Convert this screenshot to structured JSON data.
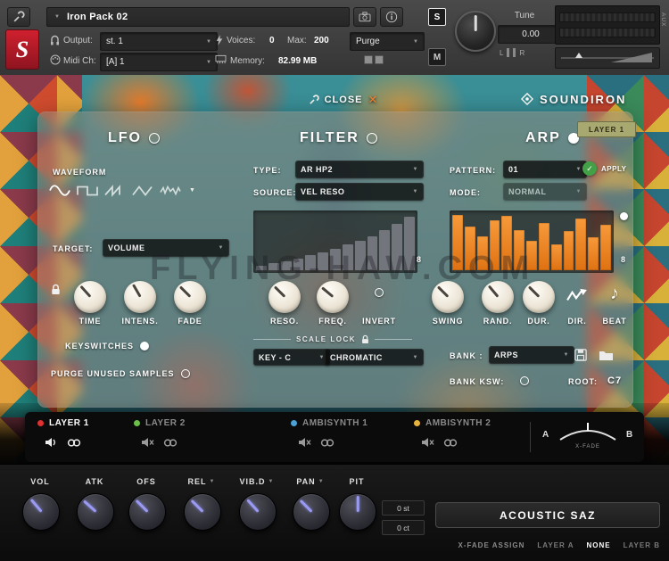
{
  "header": {
    "title": "Iron Pack 02",
    "output_label": "Output:",
    "output_value": "st. 1",
    "voices_label": "Voices:",
    "voices_value": "0",
    "max_label": "Max:",
    "max_value": "200",
    "purge_label": "Purge",
    "midi_label": "Midi Ch:",
    "midi_value": "[A] 1",
    "memory_label": "Memory:",
    "memory_value": "82.99 MB",
    "solo_label": "S",
    "mute_label": "M",
    "tune_label": "Tune",
    "tune_value": "0.00",
    "aux_label": "AUX",
    "meter_left": "L",
    "meter_right": "R"
  },
  "overlay": {
    "close_label": "CLOSE",
    "brand": "SOUNDIRON",
    "layer_badge": "LAYER 1",
    "watermark": "FLYING-HAW.COM"
  },
  "lfo": {
    "title": "LFO",
    "waveform_label": "WAVEFORM",
    "target_label": "TARGET:",
    "target_value": "VOLUME",
    "time_label": "TIME",
    "intensity_label": "INTENS.",
    "fade_label": "FADE",
    "keyswitches_label": "KEYSWITCHES",
    "purge_unused_label": "PURGE UNUSED SAMPLES"
  },
  "filter": {
    "title": "FILTER",
    "type_label": "TYPE:",
    "type_value": "AR HP2",
    "source_label": "SOURCE:",
    "source_value": "VEL RESO",
    "bars": [
      8,
      12,
      16,
      21,
      26,
      32,
      38,
      45,
      52,
      60,
      70,
      82,
      93
    ],
    "graph_max": "8",
    "reso_label": "RESO.",
    "freq_label": "FREQ.",
    "invert_label": "INVERT",
    "scale_lock_label": "SCALE LOCK",
    "key_value": "KEY - C",
    "scale_value": "CHROMATIC"
  },
  "arp": {
    "title": "ARP",
    "pattern_label": "PATTERN:",
    "pattern_value": "01",
    "apply_label": "APPLY",
    "mode_label": "MODE:",
    "mode_value": "NORMAL",
    "bars": [
      97,
      76,
      60,
      88,
      95,
      70,
      52,
      83,
      45,
      68,
      90,
      58,
      79
    ],
    "graph_max": "8",
    "swing_label": "SWING",
    "rand_label": "RAND.",
    "dur_label": "DUR.",
    "dir_label": "DIR.",
    "beat_label": "BEAT",
    "bank_label": "BANK :",
    "bank_value": "ARPS",
    "bank_ksw_label": "BANK KSW:",
    "root_label": "ROOT:",
    "root_value": "C7"
  },
  "layers": {
    "items": [
      {
        "label": "LAYER 1",
        "color": "#e03131"
      },
      {
        "label": "LAYER 2",
        "color": "#6cc04a"
      },
      {
        "label": "AMBISYNTH 1",
        "color": "#4aa3d8"
      },
      {
        "label": "AMBISYNTH 2",
        "color": "#e8b33a"
      }
    ],
    "a_label": "A",
    "b_label": "B",
    "xfade_label": "X-FADE"
  },
  "bottom": {
    "vol_label": "VOL",
    "atk_label": "ATK",
    "ofs_label": "OFS",
    "rel_label": "REL",
    "vibd_label": "VIB.D",
    "pan_label": "PAN",
    "pit_label": "PIT",
    "pitch_st": "0 st",
    "pitch_ct": "0 ct",
    "instrument_name": "ACOUSTIC SAZ",
    "xfade_assign_label": "X-FADE ASSIGN",
    "layer_a_label": "LAYER A",
    "none_label": "NONE",
    "layer_b_label": "LAYER B"
  },
  "colors": {
    "arp_bar": "#ef8a1f",
    "accent_red": "#d0202e",
    "apply_green": "#43a047",
    "badge_khaki": "#a8a871"
  }
}
